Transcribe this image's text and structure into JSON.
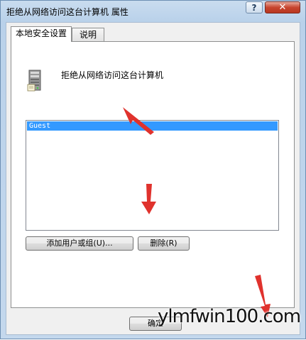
{
  "window": {
    "title": "拒绝从网络访问这台计算机 属性"
  },
  "titlebar": {
    "help_label": "?",
    "close_label": "✕"
  },
  "tabs": [
    {
      "label": "本地安全设置",
      "active": true
    },
    {
      "label": "说明",
      "active": false
    }
  ],
  "policy": {
    "icon": "server-icon",
    "name": "拒绝从网络访问这台计算机"
  },
  "list": {
    "items": [
      "Guest"
    ],
    "selected_index": 0,
    "selection_color": "#3399ff"
  },
  "buttons": {
    "add": "添加用户或组(U)...",
    "remove": "删除(R)",
    "ok": "确定"
  },
  "watermark": {
    "text": "ylmfwin100.com"
  },
  "annotation_color": "#e0322d"
}
